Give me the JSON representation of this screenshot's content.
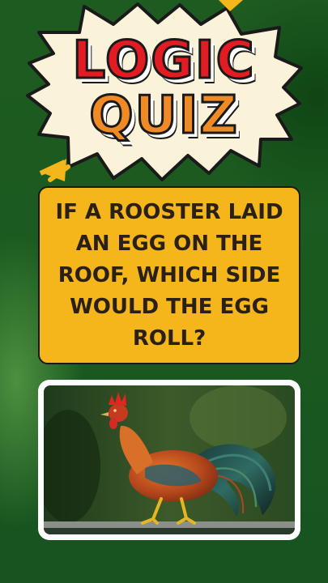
{
  "title": {
    "line1": "LOGIC",
    "line2": "QUIZ"
  },
  "question": "IF A ROOSTER LAID AN EGG ON THE ROOF, WHICH SIDE WOULD THE EGG ROLL?",
  "image": {
    "subject": "rooster-photo"
  },
  "colors": {
    "background": "#1f5a22",
    "burst_fill": "#fbf3d9",
    "title_logic": "#e31b23",
    "title_quiz": "#f08a24",
    "question_box": "#f5b61b",
    "accent": "#f5b61b"
  }
}
